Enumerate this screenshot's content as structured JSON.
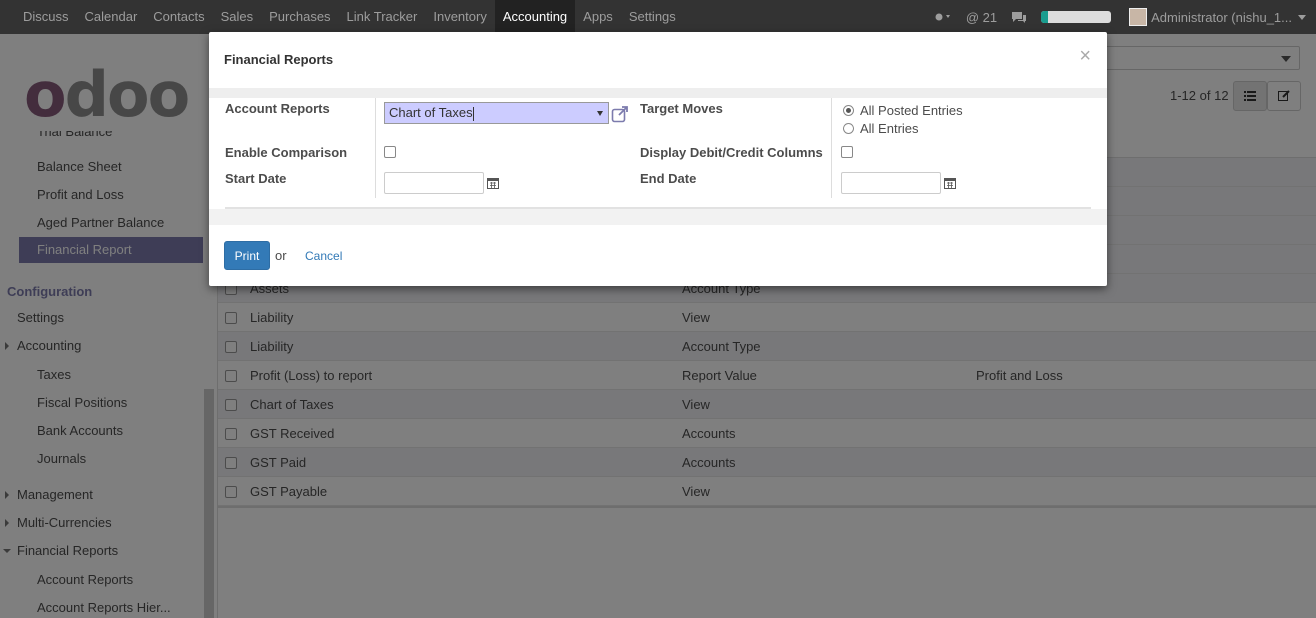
{
  "topbar": {
    "menu": [
      "Discuss",
      "Calendar",
      "Contacts",
      "Sales",
      "Purchases",
      "Link Tracker",
      "Inventory",
      "Accounting",
      "Apps",
      "Settings"
    ],
    "active_menu": "Accounting",
    "notif_count": "@ 21",
    "progress_fraction": 0.1,
    "user": "Administrator (nishu_1..."
  },
  "sidebar": {
    "logo": "odoo",
    "truncated_item": "Trial Balance",
    "report_items": [
      "Balance Sheet",
      "Profit and Loss",
      "Aged Partner Balance"
    ],
    "active_item": "Financial Report",
    "config_header": "Configuration",
    "settings": "Settings",
    "accounting": "Accounting",
    "accounting_items": [
      "Taxes",
      "Fiscal Positions",
      "Bank Accounts",
      "Journals"
    ],
    "management": "Management",
    "multi_currencies": "Multi-Currencies",
    "financial_reports": "Financial Reports",
    "fr_items": [
      "Account Reports",
      "Account Reports Hier..."
    ]
  },
  "main": {
    "pager": "1-12 of 12",
    "rows": [
      {
        "name": "Assets",
        "type": "Account Type",
        "parent": ""
      },
      {
        "name": "Liability",
        "type": "View",
        "parent": ""
      },
      {
        "name": "Liability",
        "type": "Account Type",
        "parent": ""
      },
      {
        "name": "Profit (Loss) to report",
        "type": "Report Value",
        "parent": "Profit and Loss"
      },
      {
        "name": "Chart of Taxes",
        "type": "View",
        "parent": ""
      },
      {
        "name": "GST Received",
        "type": "Accounts",
        "parent": ""
      },
      {
        "name": "GST Paid",
        "type": "Accounts",
        "parent": ""
      },
      {
        "name": "GST Payable",
        "type": "View",
        "parent": ""
      }
    ]
  },
  "modal": {
    "title": "Financial Reports",
    "close": "×",
    "account_reports_label": "Account Reports",
    "account_reports_value": "Chart of Taxes",
    "target_moves_label": "Target Moves",
    "target_moves_options": [
      "All Posted Entries",
      "All Entries"
    ],
    "target_moves_selected": "All Posted Entries",
    "enable_comparison_label": "Enable Comparison",
    "display_debit_credit_label": "Display Debit/Credit Columns",
    "start_date_label": "Start Date",
    "start_date_value": "",
    "end_date_label": "End Date",
    "end_date_value": "",
    "print_label": "Print",
    "or_label": "or",
    "cancel_label": "Cancel"
  },
  "colors": {
    "navbar": "#333333",
    "accent_purple": "#7c7bad",
    "primary_button": "#337ab7",
    "select_highlight": "#ccccff"
  }
}
